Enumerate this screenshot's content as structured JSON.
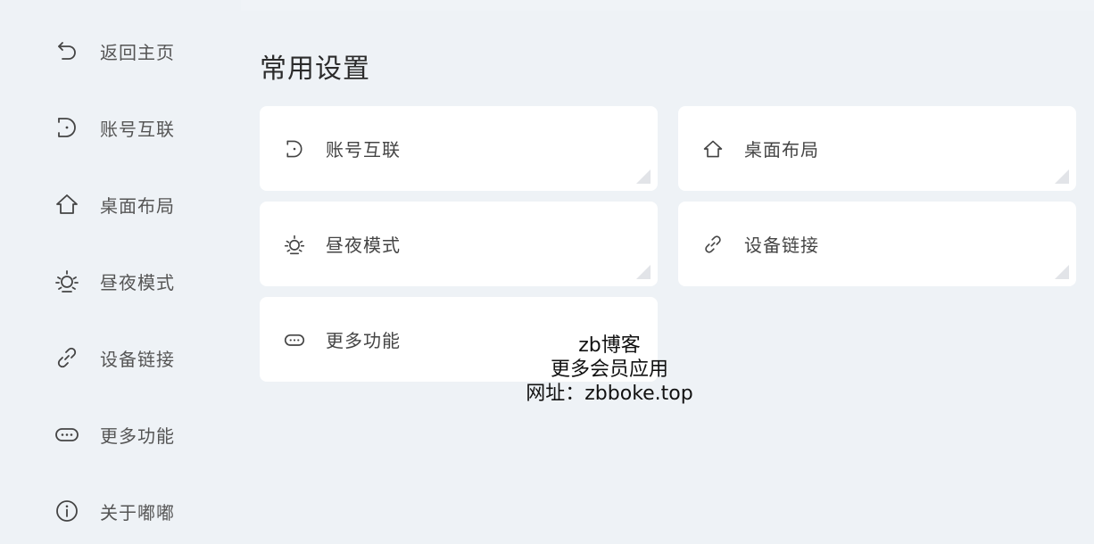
{
  "sidebar": {
    "items": [
      {
        "label": "返回主页",
        "icon": "back-arrow-icon"
      },
      {
        "label": "账号互联",
        "icon": "account-link-icon"
      },
      {
        "label": "桌面布局",
        "icon": "home-icon"
      },
      {
        "label": "昼夜模式",
        "icon": "sun-icon"
      },
      {
        "label": "设备链接",
        "icon": "link-icon"
      },
      {
        "label": "更多功能",
        "icon": "more-icon"
      },
      {
        "label": "关于嘟嘟",
        "icon": "info-icon"
      }
    ]
  },
  "main": {
    "title": "常用设置",
    "cards": [
      {
        "label": "账号互联",
        "icon": "account-link-icon"
      },
      {
        "label": "桌面布局",
        "icon": "home-icon"
      },
      {
        "label": "昼夜模式",
        "icon": "sun-icon"
      },
      {
        "label": "设备链接",
        "icon": "link-icon"
      },
      {
        "label": "更多功能",
        "icon": "more-icon"
      }
    ]
  },
  "watermark": {
    "line1": "zb博客",
    "line2": "更多会员应用",
    "line3": "网址：zbboke.top"
  },
  "colors": {
    "background": "#eef2f6",
    "card": "#ffffff",
    "text": "#555555"
  }
}
